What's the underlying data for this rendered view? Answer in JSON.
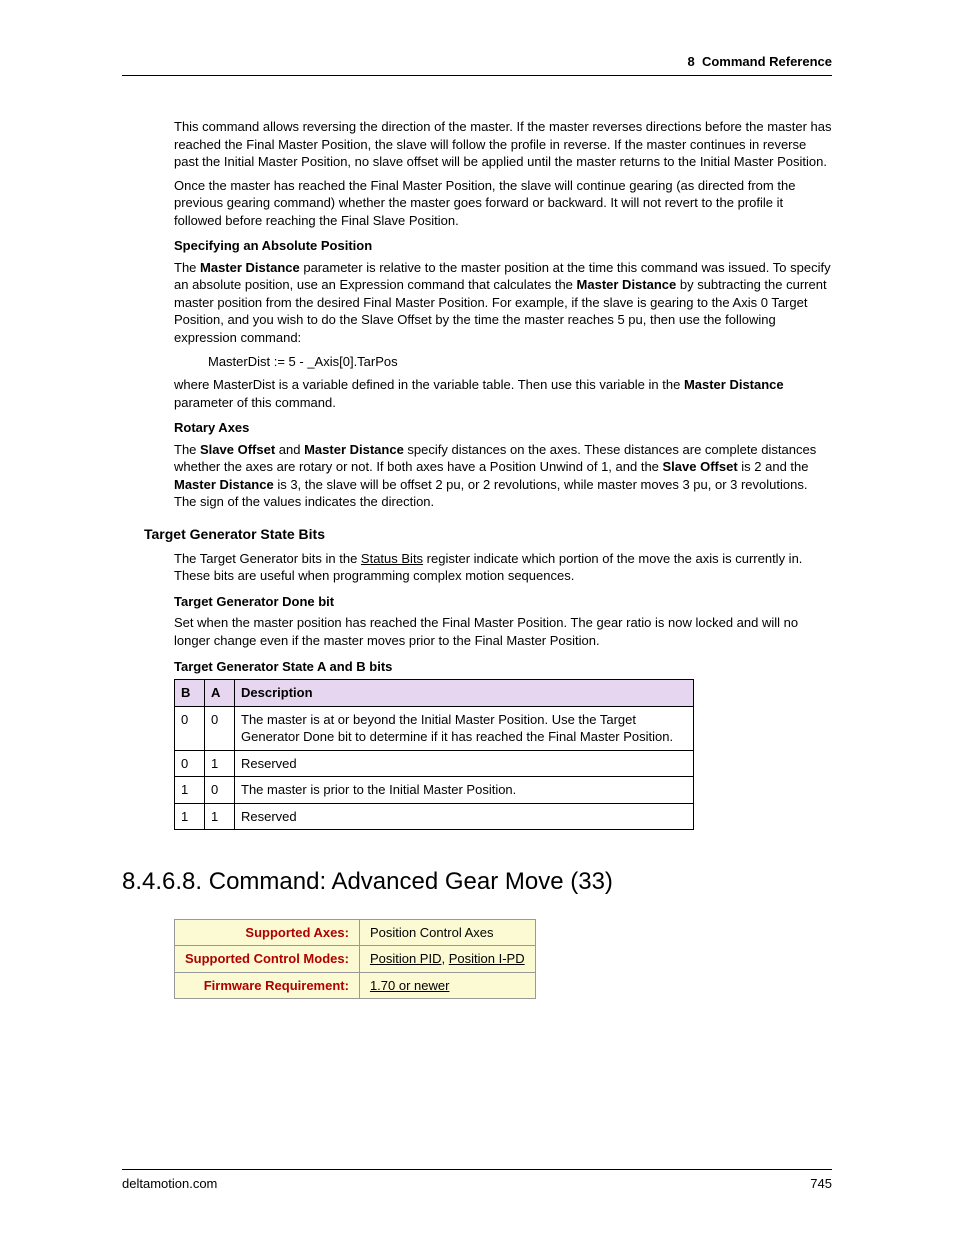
{
  "header": {
    "chapter_num": "8",
    "chapter_title": "Command Reference"
  },
  "body": {
    "p1": "This command allows reversing the direction of the master. If the master reverses directions before the master has reached the Final Master Position, the slave will follow the profile in reverse. If the master continues in reverse past the Initial Master Position, no slave offset will be applied until the master returns to the Initial Master Position.",
    "p2": "Once the master has reached the Final Master Position, the slave will continue gearing (as directed from the previous gearing command) whether the master goes forward or backward. It will not revert to the profile it followed before reaching the Final Slave Position.",
    "h_abs": "Specifying an Absolute Position",
    "abs_pre": "The ",
    "abs_b1": "Master Distance",
    "abs_mid": " parameter is relative to the master position at the time this command was issued. To specify an absolute position, use an Expression command that calculates the ",
    "abs_b2": "Master Distance",
    "abs_post": " by subtracting the current master position from the desired Final Master Position. For example, if the slave is gearing to the Axis 0 Target Position, and you wish to do the Slave Offset by the time the master reaches 5 pu, then use the following expression command:",
    "code": "MasterDist := 5 - _Axis[0].TarPos",
    "abs_where_pre": "where MasterDist is a variable defined in the variable table. Then use this variable in the ",
    "abs_where_b": "Master Distance",
    "abs_where_post": " parameter of this command.",
    "h_rot": "Rotary Axes",
    "rot_pre": "The ",
    "rot_b1": "Slave Offset",
    "rot_and": " and ",
    "rot_b2": "Master Distance",
    "rot_mid": " specify distances on the axes. These distances are complete distances whether the axes are rotary or not. If both axes have a Position Unwind of 1, and the ",
    "rot_b3": "Slave Offset",
    "rot_mid2": " is 2 and the ",
    "rot_b4": "Master Distance",
    "rot_post": " is 3, the slave will be offset 2 pu, or 2 revolutions, while master moves 3 pu, or 3 revolutions. The sign of the values indicates the direction.",
    "h_tgs": "Target Generator State Bits",
    "tgs_pre": "The Target Generator bits in the ",
    "tgs_link": "Status Bits",
    "tgs_post": " register indicate which portion of the move the axis is currently in. These bits are useful when programming complex motion sequences.",
    "h_done": "Target Generator Done bit",
    "done_p": "Set when the master position has reached the Final Master Position. The gear ratio is now locked and will no longer change even if the master moves prior to the Final Master Position.",
    "h_ab": "Target Generator State A and B bits",
    "table": {
      "headers": {
        "b": "B",
        "a": "A",
        "desc": "Description"
      },
      "rows": [
        {
          "b": "0",
          "a": "0",
          "desc": "The master is at or beyond the Initial Master Position. Use the Target Generator Done bit to determine if it has reached the Final Master Position."
        },
        {
          "b": "0",
          "a": "1",
          "desc": "Reserved"
        },
        {
          "b": "1",
          "a": "0",
          "desc": "The master is prior to the Initial Master Position."
        },
        {
          "b": "1",
          "a": "1",
          "desc": "Reserved"
        }
      ]
    },
    "h_cmd": "8.4.6.8. Command: Advanced Gear Move (33)",
    "info": {
      "rows": [
        {
          "label": "Supported Axes:",
          "value_plain": "Position Control Axes"
        },
        {
          "label": "Supported Control Modes:",
          "link1": "Position PID",
          "sep": ", ",
          "link2": "Position I-PD"
        },
        {
          "label": "Firmware Requirement:",
          "link1": "1.70 or newer"
        }
      ]
    }
  },
  "footer": {
    "site": "deltamotion.com",
    "page": "745"
  }
}
